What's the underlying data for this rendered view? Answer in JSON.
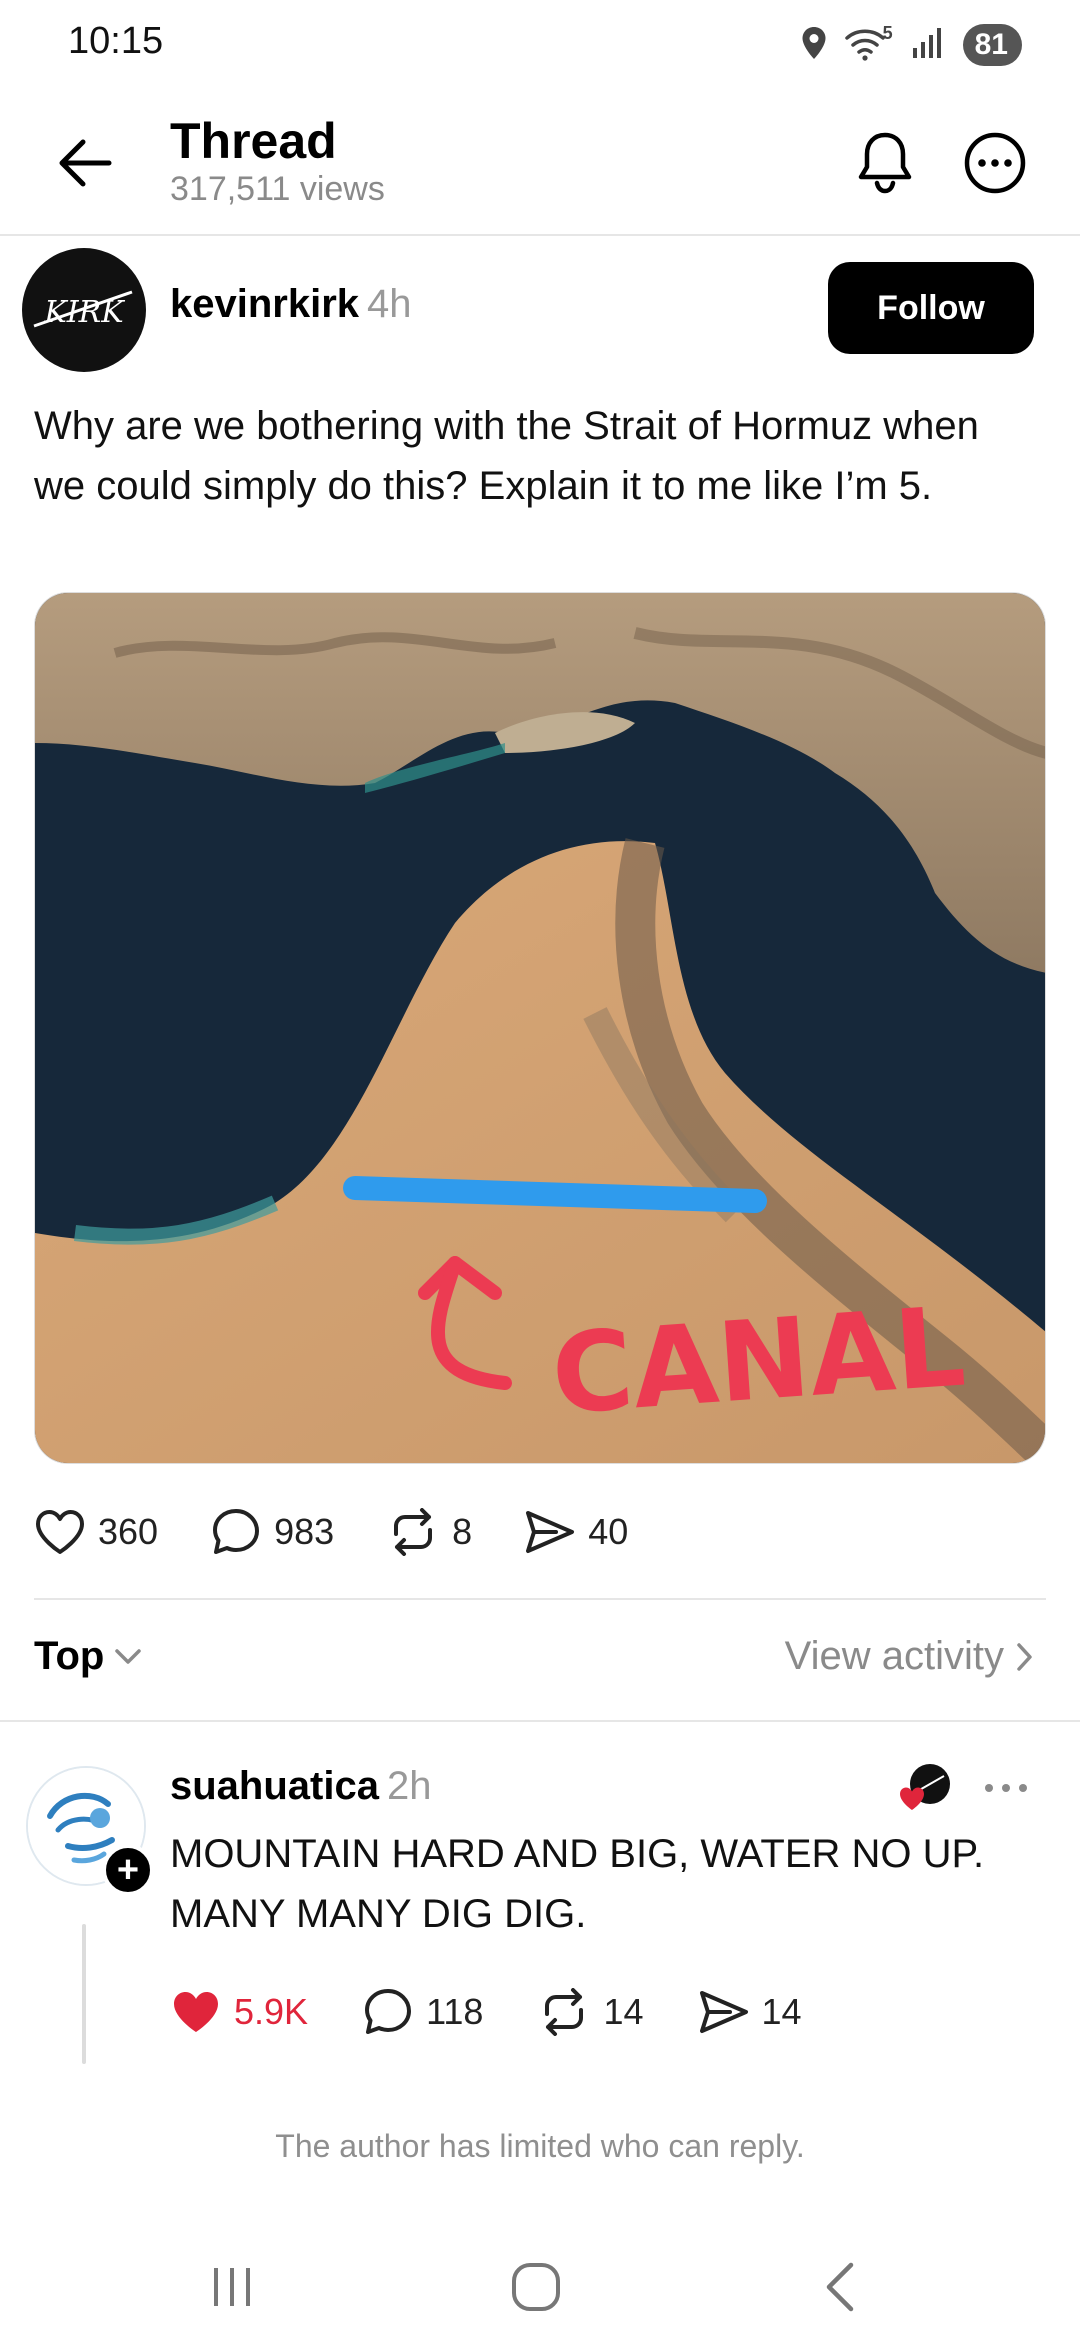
{
  "status_bar": {
    "time": "10:15",
    "network": "5",
    "battery": "81"
  },
  "header": {
    "title": "Thread",
    "views": "317,511 views"
  },
  "post": {
    "avatar_text": "KIRK",
    "username": "kevinrkirk",
    "time": "4h",
    "follow_label": "Follow",
    "text": "Why are we bothering with the Strait of Hormuz when we could simply do this? Explain it to me like I’m 5.",
    "image_annotation": "CANAL",
    "likes": "360",
    "replies": "983",
    "reposts": "8",
    "shares": "40"
  },
  "sort": {
    "label": "Top",
    "view_activity": "View activity"
  },
  "reply": {
    "username": "suahuatica",
    "time": "2h",
    "text": "MOUNTAIN HARD AND BIG, WATER NO UP. MANY MANY DIG DIG.",
    "likes": "5.9K",
    "replies": "118",
    "reposts": "14",
    "shares": "14",
    "like_color": "#e0253b"
  },
  "limited_note": "The author has limited who can reply."
}
